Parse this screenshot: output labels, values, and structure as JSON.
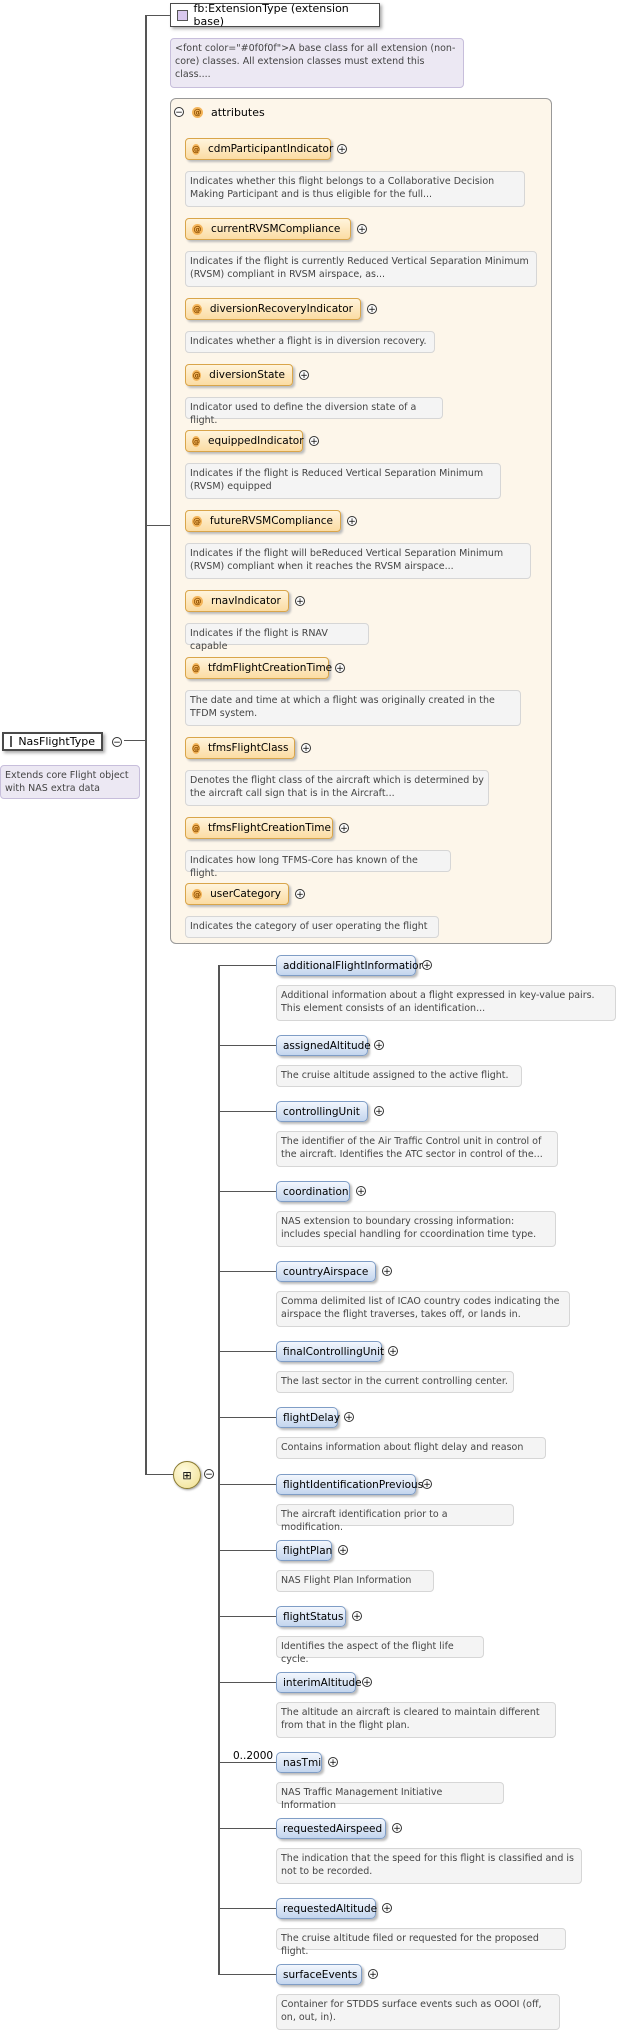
{
  "root": {
    "name": "NasFlightType",
    "doc": "Extends core Flight object with NAS extra data"
  },
  "extension": {
    "name": "fb:ExtensionType (extension base)",
    "doc": "<font color=\"#0f0f0f\">A base class for all extension (non-core) classes. All extension classes must extend this class...."
  },
  "attributes": {
    "title": "attributes",
    "items": [
      {
        "name": "cdmParticipantIndicator",
        "doc": "Indicates whether this flight belongs to a Collaborative Decision Making Participant and is thus eligible for the full..."
      },
      {
        "name": "currentRVSMCompliance",
        "doc": "Indicates if the flight is currently Reduced Vertical Separation Minimum (RVSM) compliant in RVSM airspace, as..."
      },
      {
        "name": "diversionRecoveryIndicator",
        "doc": "Indicates whether a flight is in diversion recovery."
      },
      {
        "name": "diversionState",
        "doc": "Indicator used to define the diversion state of a flight."
      },
      {
        "name": "equippedIndicator",
        "doc": "Indicates if the flight is Reduced Vertical Separation Minimum (RVSM) equipped"
      },
      {
        "name": "futureRVSMCompliance",
        "doc": "Indicates if the flight will beReduced Vertical Separation Minimum (RVSM) compliant when it reaches the RVSM airspace..."
      },
      {
        "name": "rnavIndicator",
        "doc": "Indicates if the flight is RNAV capable"
      },
      {
        "name": "tfdmFlightCreationTime",
        "doc": "The date and time at which a flight was originally created in the TFDM system."
      },
      {
        "name": "tfmsFlightClass",
        "doc": "Denotes the flight class of the aircraft which is determined by the aircraft call sign that is in the Aircraft..."
      },
      {
        "name": "tfmsFlightCreationTime",
        "doc": "Indicates how long TFMS-Core has known of the flight."
      },
      {
        "name": "userCategory",
        "doc": "Indicates the category of user operating the flight"
      }
    ]
  },
  "sequence": {
    "cardinality": "0..2000",
    "elements": [
      {
        "name": "additionalFlightInformation",
        "doc": "Additional information about a flight expressed in key-value pairs. This element consists of an identification..."
      },
      {
        "name": "assignedAltitude",
        "doc": "The cruise altitude assigned to the active flight."
      },
      {
        "name": "controllingUnit",
        "doc": "The identifier of the Air Traffic Control unit in control of the aircraft. Identifies the ATC sector in control of the..."
      },
      {
        "name": "coordination",
        "doc": "NAS extension to boundary crossing information: includes special handling for ccoordination time type."
      },
      {
        "name": "countryAirspace",
        "doc": "Comma delimited list of ICAO country codes indicating the airspace the flight traverses, takes off, or lands in."
      },
      {
        "name": "finalControllingUnit",
        "doc": "The last sector in the current controlling center."
      },
      {
        "name": "flightDelay",
        "doc": "Contains information about flight delay and reason"
      },
      {
        "name": "flightIdentificationPrevious",
        "doc": "The aircraft identification prior to a modification."
      },
      {
        "name": "flightPlan",
        "doc": "NAS Flight Plan Information"
      },
      {
        "name": "flightStatus",
        "doc": "Identifies the aspect of the flight life cycle."
      },
      {
        "name": "interimAltitude",
        "doc": "The altitude an aircraft is cleared to maintain different from that in the flight plan."
      },
      {
        "name": "nasTmi",
        "doc": "NAS Traffic Management Initiative Information"
      },
      {
        "name": "requestedAirspeed",
        "doc": "The indication that the speed for this flight is classified and is not to be recorded."
      },
      {
        "name": "requestedAltitude",
        "doc": "The cruise altitude filed or requested for the proposed flight."
      },
      {
        "name": "surfaceEvents",
        "doc": "Container for STDDS surface events such as OOOI (off, on, out, in)."
      }
    ]
  },
  "icons": {
    "collapse": "minus-circle-icon",
    "expand": "plus-circle-icon",
    "type": "complex-type-icon",
    "attribute": "attribute-icon",
    "sequence": "sequence-icon"
  }
}
